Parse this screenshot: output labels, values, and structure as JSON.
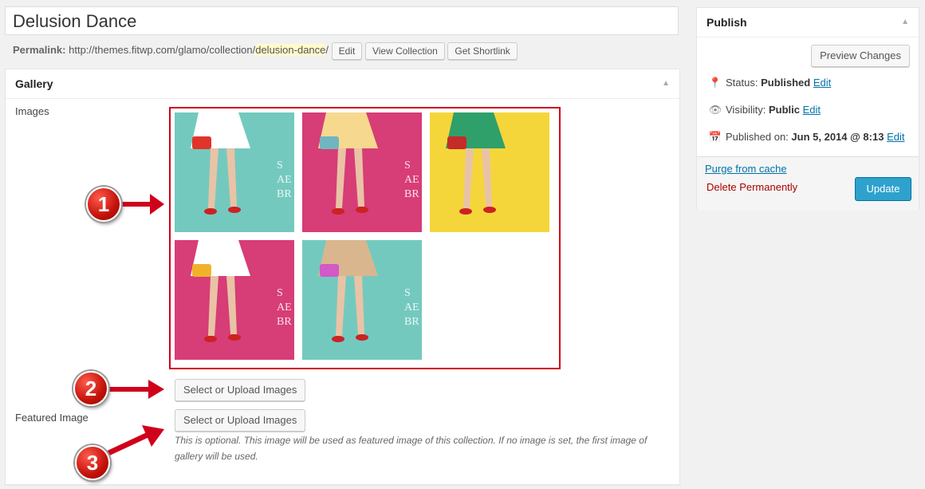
{
  "post": {
    "title": "Delusion Dance",
    "permalink_label": "Permalink:",
    "permalink_base": "http://themes.fitwp.com/glamo/collection/",
    "permalink_slug": "delusion-dance",
    "permalink_trailing": "/",
    "edit_label": "Edit",
    "view_label": "View Collection",
    "shortlink_label": "Get Shortlink"
  },
  "gallery": {
    "title": "Gallery",
    "images_label": "Images",
    "select_images_label": "Select or Upload Images",
    "featured_label": "Featured Image",
    "select_featured_label": "Select or Upload Images",
    "note": "This is optional. This image will be used as featured image of this collection. If no image is set, the first image of gallery will be used.",
    "thumbs": [
      {
        "name": "thumb-1",
        "bg": "#74c9bf",
        "dress": "#ffffff",
        "bag": "#e0342a"
      },
      {
        "name": "thumb-2",
        "bg": "#d73d76",
        "dress": "#f6d98f",
        "bag": "#6fb6c0"
      },
      {
        "name": "thumb-3",
        "bg": "#f5d63a",
        "dress": "#2fa06a",
        "bag": "#c42b2b"
      },
      {
        "name": "thumb-4",
        "bg": "#d73d76",
        "dress": "#ffffff",
        "bag": "#f1b22a"
      },
      {
        "name": "thumb-5",
        "bg": "#74c9bf",
        "dress": "#d9b68e",
        "bag": "#d259c6"
      }
    ],
    "brand_text": "S\nAE\nBR"
  },
  "publish": {
    "title": "Publish",
    "preview_label": "Preview Changes",
    "status_label": "Status:",
    "status_value": "Published",
    "visibility_label": "Visibility:",
    "visibility_value": "Public",
    "published_label": "Published on:",
    "published_value": "Jun 5, 2014 @ 8:13",
    "edit_label": "Edit",
    "purge_label": "Purge from cache",
    "delete_label": "Delete Permanently",
    "update_label": "Update"
  },
  "callouts": [
    "1",
    "2",
    "3"
  ],
  "colors": {
    "accent": "#2ea2cc",
    "link": "#0073aa",
    "delete": "#a00",
    "annotation": "#d0011b"
  }
}
